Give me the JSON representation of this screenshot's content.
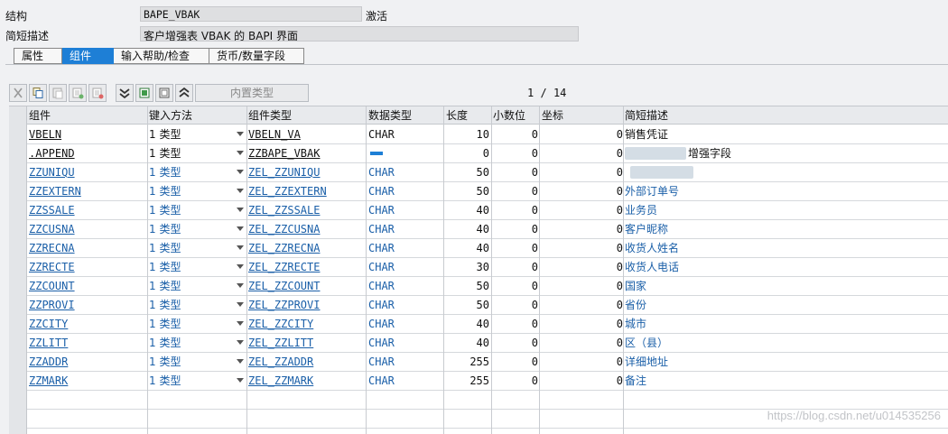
{
  "header": {
    "struct_label": "结构",
    "struct_value": "BAPE_VBAK",
    "status": "激活",
    "desc_label": "简短描述",
    "desc_value": "客户增强表 VBAK 的 BAPI 界面"
  },
  "tabs": [
    {
      "label": "属性",
      "active": false
    },
    {
      "label": "组件",
      "active": true
    },
    {
      "label": "输入帮助/检查",
      "active": false
    },
    {
      "label": "货币/数量字段",
      "active": false
    }
  ],
  "toolbar": {
    "builtin_type_label": "内置类型",
    "icons": [
      "cut-icon",
      "copy-icon",
      "paste-icon",
      "insert-row-icon",
      "delete-row-icon",
      "expand-icon",
      "select-all-icon",
      "deselect-icon",
      "collapse-icon"
    ]
  },
  "pager": {
    "current": "1",
    "separator": "/",
    "total": "14"
  },
  "table": {
    "columns": [
      "组件",
      "键入方法",
      "组件类型",
      "数据类型",
      "长度",
      "小数位",
      "坐标",
      "简短描述"
    ],
    "rows": [
      {
        "component": "VBELN",
        "method": "1 类型",
        "type": "VBELN_VA",
        "dtype": "CHAR",
        "length": "10",
        "decimals": "0",
        "coord": "0",
        "desc": "销售凭证",
        "style": "black"
      },
      {
        "component": ".APPEND",
        "method": "1 类型",
        "type": "ZZBAPE_VBAK",
        "dtype": "",
        "length": "0",
        "decimals": "0",
        "coord": "0",
        "desc": "增强字段",
        "style": "black"
      },
      {
        "component": "ZZUNIQU",
        "method": "1 类型",
        "type": "ZEL_ZZUNIQU",
        "dtype": "CHAR",
        "length": "50",
        "decimals": "0",
        "coord": "0",
        "desc": "",
        "style": "blue"
      },
      {
        "component": "ZZEXTERN",
        "method": "1 类型",
        "type": "ZEL_ZZEXTERN",
        "dtype": "CHAR",
        "length": "50",
        "decimals": "0",
        "coord": "0",
        "desc": "外部订单号",
        "style": "blue"
      },
      {
        "component": "ZZSSALE",
        "method": "1 类型",
        "type": "ZEL_ZZSSALE",
        "dtype": "CHAR",
        "length": "40",
        "decimals": "0",
        "coord": "0",
        "desc": "业务员",
        "style": "blue"
      },
      {
        "component": "ZZCUSNA",
        "method": "1 类型",
        "type": "ZEL_ZZCUSNA",
        "dtype": "CHAR",
        "length": "40",
        "decimals": "0",
        "coord": "0",
        "desc": "客户昵称",
        "style": "blue"
      },
      {
        "component": "ZZRECNA",
        "method": "1 类型",
        "type": "ZEL_ZZRECNA",
        "dtype": "CHAR",
        "length": "40",
        "decimals": "0",
        "coord": "0",
        "desc": "收货人姓名",
        "style": "blue"
      },
      {
        "component": "ZZRECTE",
        "method": "1 类型",
        "type": "ZEL_ZZRECTE",
        "dtype": "CHAR",
        "length": "30",
        "decimals": "0",
        "coord": "0",
        "desc": "收货人电话",
        "style": "blue"
      },
      {
        "component": "ZZCOUNT",
        "method": "1 类型",
        "type": "ZEL_ZZCOUNT",
        "dtype": "CHAR",
        "length": "50",
        "decimals": "0",
        "coord": "0",
        "desc": "国家",
        "style": "blue"
      },
      {
        "component": "ZZPROVI",
        "method": "1 类型",
        "type": "ZEL_ZZPROVI",
        "dtype": "CHAR",
        "length": "50",
        "decimals": "0",
        "coord": "0",
        "desc": "省份",
        "style": "blue"
      },
      {
        "component": "ZZCITY",
        "method": "1 类型",
        "type": "ZEL_ZZCITY",
        "dtype": "CHAR",
        "length": "40",
        "decimals": "0",
        "coord": "0",
        "desc": "城市",
        "style": "blue"
      },
      {
        "component": "ZZLITT",
        "method": "1 类型",
        "type": "ZEL_ZZLITT",
        "dtype": "CHAR",
        "length": "40",
        "decimals": "0",
        "coord": "0",
        "desc": "区（县）",
        "style": "blue"
      },
      {
        "component": "ZZADDR",
        "method": "1 类型",
        "type": "ZEL_ZZADDR",
        "dtype": "CHAR",
        "length": "255",
        "decimals": "0",
        "coord": "0",
        "desc": "详细地址",
        "style": "blue"
      },
      {
        "component": "ZZMARK",
        "method": "1 类型",
        "type": "ZEL_ZZMARK",
        "dtype": "CHAR",
        "length": "255",
        "decimals": "0",
        "coord": "0",
        "desc": "备注",
        "style": "blue"
      }
    ]
  },
  "watermark": "https://blog.csdn.net/u014535256",
  "colors": {
    "accent": "#1e7fd6",
    "link": "#1a5fa8"
  }
}
